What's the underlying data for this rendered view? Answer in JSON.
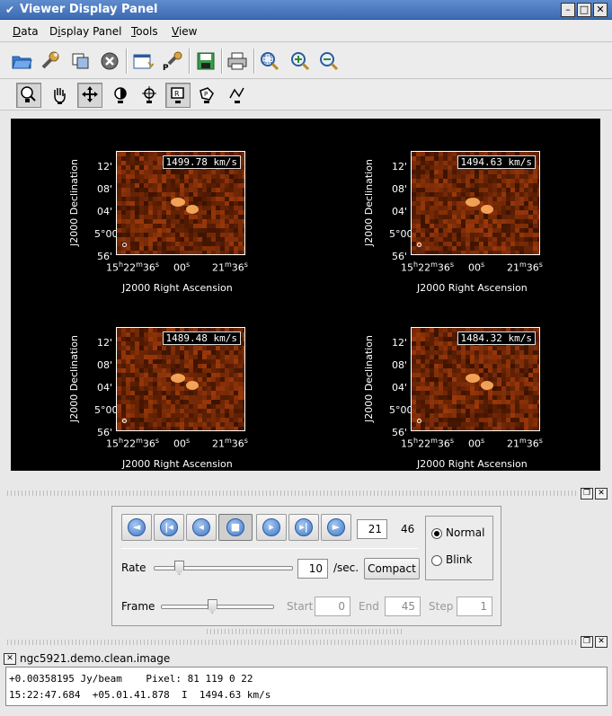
{
  "window": {
    "title": "Viewer Display Panel"
  },
  "menu": [
    {
      "pre": "",
      "u": "D",
      "post": "ata"
    },
    {
      "pre": "D",
      "u": "i",
      "post": "splay Panel"
    },
    {
      "pre": "",
      "u": "T",
      "post": "ools"
    },
    {
      "pre": "",
      "u": "V",
      "post": "iew"
    }
  ],
  "toolbar1": [
    "open-folder-icon",
    "wrench-icon",
    "copy-panels-icon",
    "close-circle-icon",
    "new-panel-icon",
    "preferences-icon",
    "save-icon",
    "print-icon",
    "zoom-fit-icon",
    "zoom-in-icon",
    "zoom-out-icon"
  ],
  "toolbar2": [
    "zoom-tool-icon",
    "pan-tool-icon",
    "move-tool-icon",
    "contrast-tool-icon",
    "crosshair-tool-icon",
    "rectangle-region-icon",
    "polygon-region-icon",
    "polyline-icon"
  ],
  "panels": [
    {
      "velocity": "1499.78 km/s"
    },
    {
      "velocity": "1494.63 km/s"
    },
    {
      "velocity": "1489.48 km/s"
    },
    {
      "velocity": "1484.32 km/s"
    }
  ],
  "axes": {
    "ylabel": "J2000 Declination",
    "xlabel": "J2000 Right Ascension",
    "yticks": [
      "12'",
      "08'",
      "04'",
      "5°00'",
      "56'"
    ],
    "xticks": [
      "15h22m36s",
      "00s",
      "21m36s"
    ]
  },
  "animator": {
    "frame_value": "21",
    "frame_total": "46",
    "rate_label": "Rate",
    "rate_value": "10",
    "rate_unit": "/sec.",
    "rate_fraction": 0.18,
    "compact_label": "Compact",
    "frame_label": "Frame",
    "frame_fraction": 0.45,
    "start_label": "Start",
    "start_value": "0",
    "end_label": "End",
    "end_value": "45",
    "step_label": "Step",
    "step_value": "1",
    "mode_normal": "Normal",
    "mode_blink": "Blink",
    "selected_mode": "Normal"
  },
  "status": {
    "image_name": "ngc5921.demo.clean.image",
    "line1": "+0.00358195 Jy/beam    Pixel: 81 119 0 22",
    "line2": "15:22:47.684  +05.01.41.878  I  1494.63 km/s"
  },
  "colors": {
    "titlebar": "#4a78be",
    "display_bg": "#000000",
    "map_low": "#2a0c00",
    "map_high": "#ffb060"
  }
}
